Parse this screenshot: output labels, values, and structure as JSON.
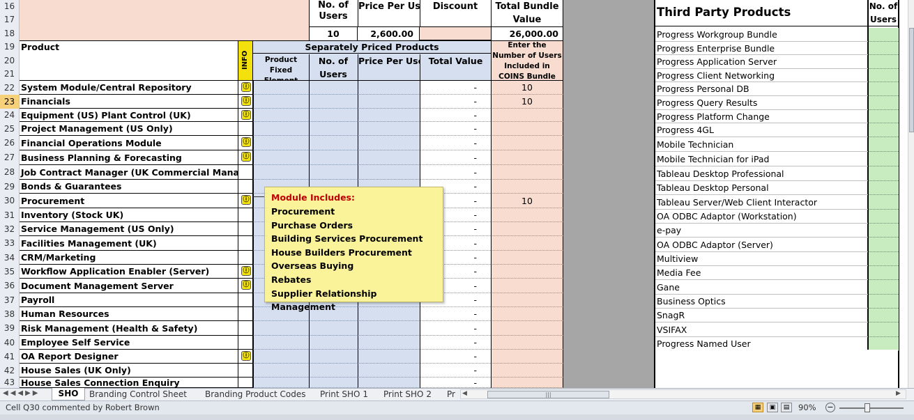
{
  "header": {
    "no_of_users": "No. of Users",
    "price_per_user": "Price Per User",
    "discount": "Discount",
    "total_bundle_value": "Total Bundle Value",
    "users_value": "10",
    "price_value": "2,600.00",
    "bundle_value": "26,000.00",
    "product_label": "Product",
    "info_label": "INFO",
    "separately_priced": "Separately Priced Products",
    "product_fixed_element": "Product Fixed Element",
    "no_of_users_sub": "No. of Users",
    "price_per_user_sub": "Price Per User",
    "total_value": "Total Value",
    "enter_number": "Enter the Number of Users Included in COINS Bundle"
  },
  "row_numbers": [
    "16",
    "17",
    "18",
    "19",
    "20",
    "21",
    "22",
    "23",
    "24",
    "25",
    "26",
    "27",
    "28",
    "29",
    "30",
    "31",
    "32",
    "33",
    "34",
    "35",
    "36",
    "37",
    "38",
    "39",
    "40",
    "41",
    "42",
    "43"
  ],
  "products": [
    {
      "row": "22",
      "name": "System Module/Central Repository",
      "info": true,
      "total": "-",
      "users": "10"
    },
    {
      "row": "23",
      "name": "Financials",
      "info": true,
      "total": "-",
      "users": "10"
    },
    {
      "row": "24",
      "name": "Equipment (US) Plant Control (UK)",
      "info": true,
      "total": "-",
      "users": ""
    },
    {
      "row": "25",
      "name": "Project Management (US Only)",
      "info": false,
      "total": "-",
      "users": ""
    },
    {
      "row": "26",
      "name": "Financial Operations Module",
      "info": true,
      "total": "-",
      "users": ""
    },
    {
      "row": "27",
      "name": "Business Planning & Forecasting",
      "info": true,
      "total": "-",
      "users": ""
    },
    {
      "row": "28",
      "name": "Job Contract Manager (UK Commercial Manager)",
      "info": false,
      "total": "-",
      "users": ""
    },
    {
      "row": "29",
      "name": "Bonds & Guarantees",
      "info": false,
      "total": "-",
      "users": ""
    },
    {
      "row": "30",
      "name": "Procurement",
      "info": true,
      "total": "-",
      "users": "10"
    },
    {
      "row": "31",
      "name": "Inventory (Stock UK)",
      "info": false,
      "total": "-",
      "users": ""
    },
    {
      "row": "32",
      "name": "Service Management (US Only)",
      "info": false,
      "total": "-",
      "users": ""
    },
    {
      "row": "33",
      "name": "Facilities Management (UK)",
      "info": false,
      "total": "-",
      "users": ""
    },
    {
      "row": "34",
      "name": "CRM/Marketing",
      "info": false,
      "total": "-",
      "users": ""
    },
    {
      "row": "35",
      "name": "Workflow Application Enabler (Server)",
      "info": true,
      "total": "-",
      "users": ""
    },
    {
      "row": "36",
      "name": "Document Management Server",
      "info": true,
      "total": "-",
      "users": ""
    },
    {
      "row": "37",
      "name": "Payroll",
      "info": false,
      "total": "-",
      "users": ""
    },
    {
      "row": "38",
      "name": "Human Resources",
      "info": false,
      "total": "-",
      "users": ""
    },
    {
      "row": "39",
      "name": "Risk Management (Health & Safety)",
      "info": false,
      "total": "-",
      "users": ""
    },
    {
      "row": "40",
      "name": "Employee Self Service",
      "info": false,
      "total": "-",
      "users": ""
    },
    {
      "row": "41",
      "name": "OA Report Designer",
      "info": true,
      "total": "-",
      "users": ""
    },
    {
      "row": "42",
      "name": "House Sales (UK Only)",
      "info": false,
      "total": "-",
      "users": ""
    },
    {
      "row": "43",
      "name": "House Sales Connection Enquiry",
      "info": false,
      "total": "-",
      "users": ""
    }
  ],
  "comment": {
    "title": "Module Includes:",
    "lines": [
      "Procurement",
      "Purchase Orders",
      "Building Services Procurement",
      "House Builders Procurement",
      "Overseas Buying",
      "Rebates",
      "Supplier Relationship Management"
    ]
  },
  "third_party": {
    "title": "Third Party Products",
    "users_header": "No. of Users",
    "items": [
      "Progress Workgroup Bundle",
      "Progress Enterprise Bundle",
      "Progress Application Server",
      "Progress Client Networking",
      "Progress Personal DB",
      "Progress Query Results",
      "Progress Platform Change",
      "Progress 4GL",
      "Mobile Technician",
      "Mobile Technician for iPad",
      "Tableau Desktop Professional",
      "Tableau Desktop Personal",
      "Tableau Server/Web Client Interactor",
      "OA ODBC Adaptor (Workstation)",
      "e-pay",
      "OA ODBC Adaptor (Server)",
      "Multiview",
      "Media Fee",
      "Gane",
      "Business Optics",
      "SnagR",
      "VSIFAX",
      "Progress Named User"
    ]
  },
  "tabs": [
    "SHO",
    "Branding Control Sheet",
    "Branding Product Codes",
    "Print SHO 1",
    "Print SHO 2",
    "Pr"
  ],
  "status": {
    "text": "Cell Q30 commented by Robert Brown",
    "zoom": "90%"
  },
  "colors": {
    "info_yellow": "#f3e10e",
    "header_peach": "#f8dcd0",
    "blue_area": "#d5dff0",
    "green_area": "#c8ebc0",
    "gray_gap": "#a6a6a6"
  }
}
